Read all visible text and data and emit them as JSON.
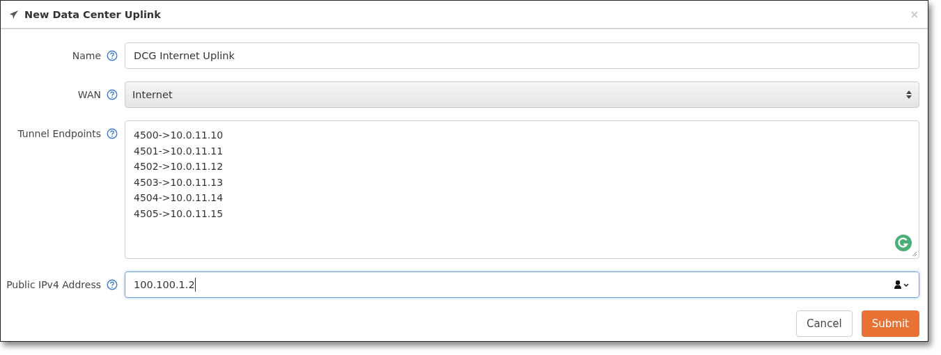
{
  "dialog": {
    "title": "New Data Center Uplink"
  },
  "fields": [
    {
      "label": "Name",
      "kind": "text",
      "value": "DCG Internet Uplink",
      "focused": false
    },
    {
      "label": "WAN",
      "kind": "select",
      "value": "Internet",
      "focused": false
    },
    {
      "label": "Tunnel Endpoints",
      "kind": "textarea",
      "lines": [
        "4500->10.0.11.10",
        "4501->10.0.11.11",
        "4502->10.0.11.12",
        "4503->10.0.11.13",
        "4504->10.0.11.14",
        "4505->10.0.11.15"
      ],
      "focused": false
    },
    {
      "label": "Public IPv4 Address",
      "kind": "text",
      "value": "100.100.1.2",
      "focused": true
    }
  ],
  "buttons": [
    {
      "label": "Cancel",
      "kind": "secondary"
    },
    {
      "label": "Submit",
      "kind": "primary"
    }
  ]
}
